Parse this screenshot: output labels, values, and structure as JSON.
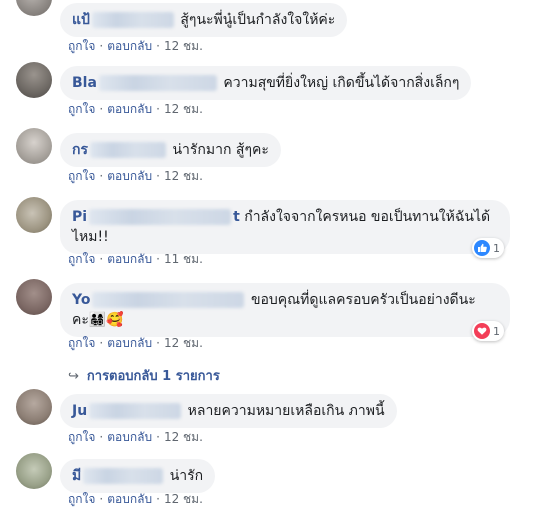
{
  "actions": {
    "like": "ถูกใจ",
    "reply": "ตอบกลับ",
    "sep": "·"
  },
  "comments": [
    {
      "name": "แป้",
      "text": "สู้ๆนะพี่นู๋เป็นกำลังใจให้ค่ะ",
      "time": "12 ชม."
    },
    {
      "name": "Bla",
      "text": "ความสุขที่ยิ่งใหญ่ เกิดขึ้นได้จากสิ่งเล็กๆ",
      "time": "12 ชม."
    },
    {
      "name": "กร",
      "text": "น่ารักมาก สู้ๆคะ",
      "time": "12 ชม."
    },
    {
      "name": "Pi",
      "name_tail": "t",
      "text": "กำลังใจจากใครหนอ ขอเป็นทานให้ฉันได้",
      "text2": "ไหม!!",
      "time": "11 ชม.",
      "reaction": {
        "icon": "like-icon",
        "count": "1"
      }
    },
    {
      "name": "Yo",
      "text": "ขอบคุณที่ดูแลครอบครัวเป็นอย่างดีนะ",
      "text2": "คะ",
      "emoji": "👨‍👩‍👧‍👦🥰",
      "time": "12 ชม.",
      "reaction": {
        "icon": "love-icon",
        "count": "1"
      }
    },
    {
      "name": "Ju",
      "text": "หลายความหมายเหลือเกิน ภาพนี้",
      "time": "12 ชม."
    },
    {
      "name": "มี",
      "text": "น่ารัก",
      "time": "12 ชม."
    }
  ],
  "replies_link": {
    "arrow": "↪",
    "label": "การตอบกลับ 1 รายการ"
  }
}
